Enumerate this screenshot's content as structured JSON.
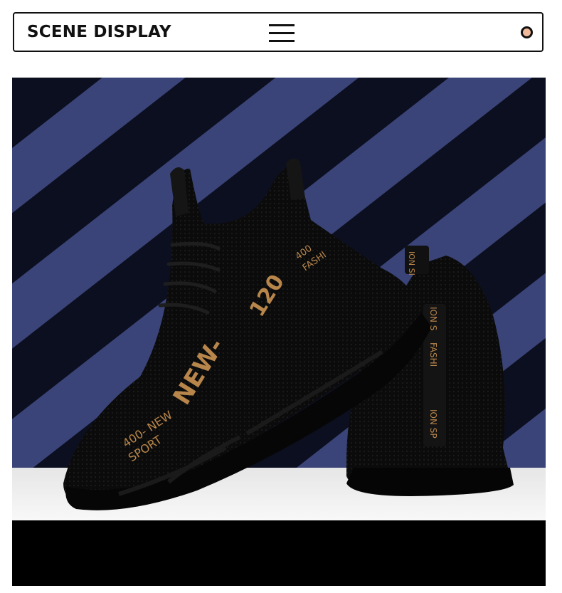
{
  "header": {
    "title": "SCENE DISPLAY",
    "menu_icon": "hamburger-menu-icon",
    "dot_icon": "circle-dot-icon",
    "dot_color": "#f0b999"
  },
  "photo": {
    "subject": "product-photo",
    "shoe_print": {
      "front_upper": "NEW-",
      "front_upper_2": "120",
      "front_side": "400- NEW",
      "front_side_2": "SPORT",
      "front_tongue": "400",
      "front_tongue_2": "FASHI",
      "back_tab": "ION SI",
      "back_heel_1": "ION S",
      "back_heel_2": "FASHI",
      "back_heel_3": "ION SP"
    },
    "colors": {
      "stripe_dark": "#0c0f1f",
      "stripe_blue": "#3a4478",
      "shoe": "#0b0b0b",
      "accent": "#b8864b",
      "floor": "#f2f2f2"
    }
  }
}
